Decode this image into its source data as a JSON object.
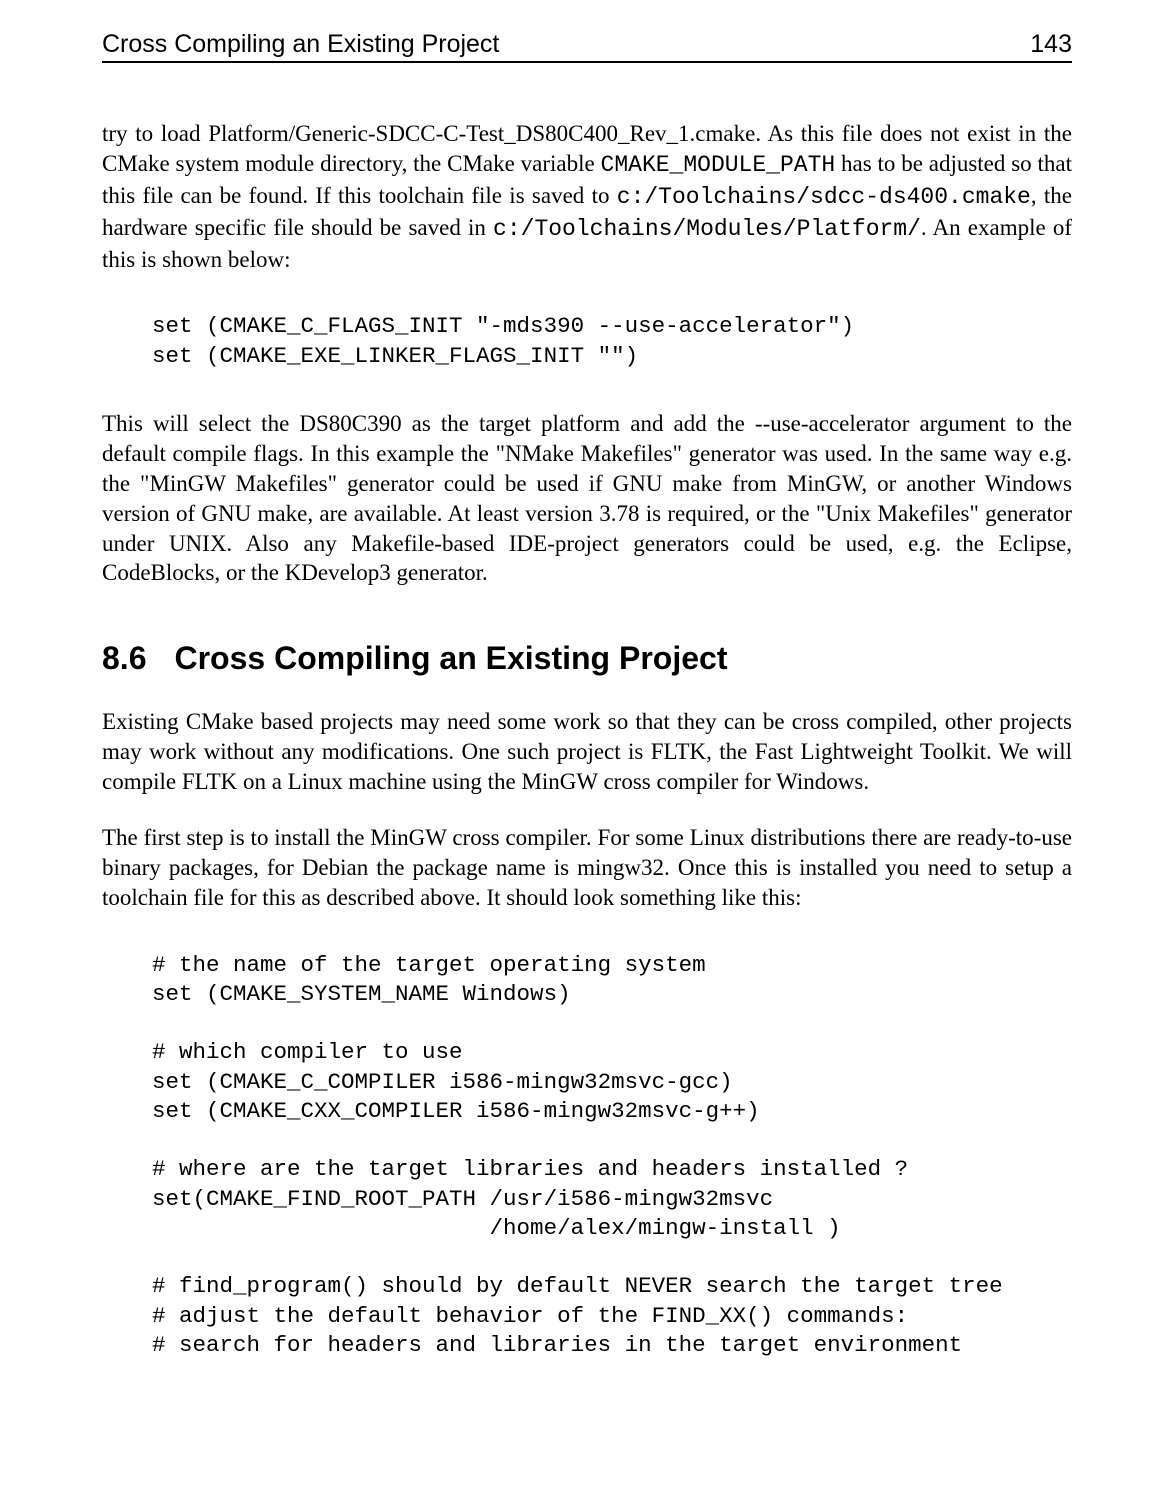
{
  "header": {
    "title": "Cross Compiling an Existing Project",
    "page_number": "143"
  },
  "para1": {
    "t1": "try to load Platform/Generic-SDCC-C-Test_DS80C400_Rev_1.cmake. As this file does not exist in the CMake system module directory, the CMake variable ",
    "m1": "CMAKE_MODULE_PATH",
    "t2": " has to be adjusted so that this file can be found. If this toolchain file is saved to ",
    "m2": "c:/Toolchains/sdcc-ds400.cmake",
    "t3": ", the hardware specific file should be saved in ",
    "m3": "c:/Toolchains/Modules/Platform/",
    "t4": ". An example of this is shown below:"
  },
  "code1": "set (CMAKE_C_FLAGS_INIT \"-mds390 --use-accelerator\")\nset (CMAKE_EXE_LINKER_FLAGS_INIT \"\")",
  "para2": "This will select the DS80C390 as the target platform and add the --use-accelerator argument to the default compile flags. In this example the \"NMake Makefiles\" generator was used. In the same way e.g. the \"MinGW Makefiles\" generator could be used if GNU make from MinGW, or another Windows version of GNU make, are available. At least version 3.78 is required, or the \"Unix Makefiles\" generator under UNIX. Also any Makefile-based IDE-project generators could be used, e.g. the Eclipse, CodeBlocks, or the KDevelop3 generator.",
  "section": {
    "number": "8.6",
    "title": "Cross Compiling an Existing Project"
  },
  "para3": "Existing CMake based projects may need some work so that they can be cross compiled, other projects may work without any modifications. One such project is FLTK, the Fast Lightweight Toolkit. We will compile FLTK on a Linux machine using the MinGW cross compiler for Windows.",
  "para4": "The first step is to install the MinGW cross compiler. For some Linux distributions there are ready-to-use binary packages, for Debian the package name is mingw32. Once this is installed you need to setup a toolchain file for this as described above. It should look something like this:",
  "code2": "# the name of the target operating system\nset (CMAKE_SYSTEM_NAME Windows)\n\n# which compiler to use\nset (CMAKE_C_COMPILER i586-mingw32msvc-gcc)\nset (CMAKE_CXX_COMPILER i586-mingw32msvc-g++)\n\n# where are the target libraries and headers installed ?\nset(CMAKE_FIND_ROOT_PATH /usr/i586-mingw32msvc\n                         /home/alex/mingw-install )\n\n# find_program() should by default NEVER search the target tree\n# adjust the default behavior of the FIND_XX() commands:\n# search for headers and libraries in the target environment"
}
